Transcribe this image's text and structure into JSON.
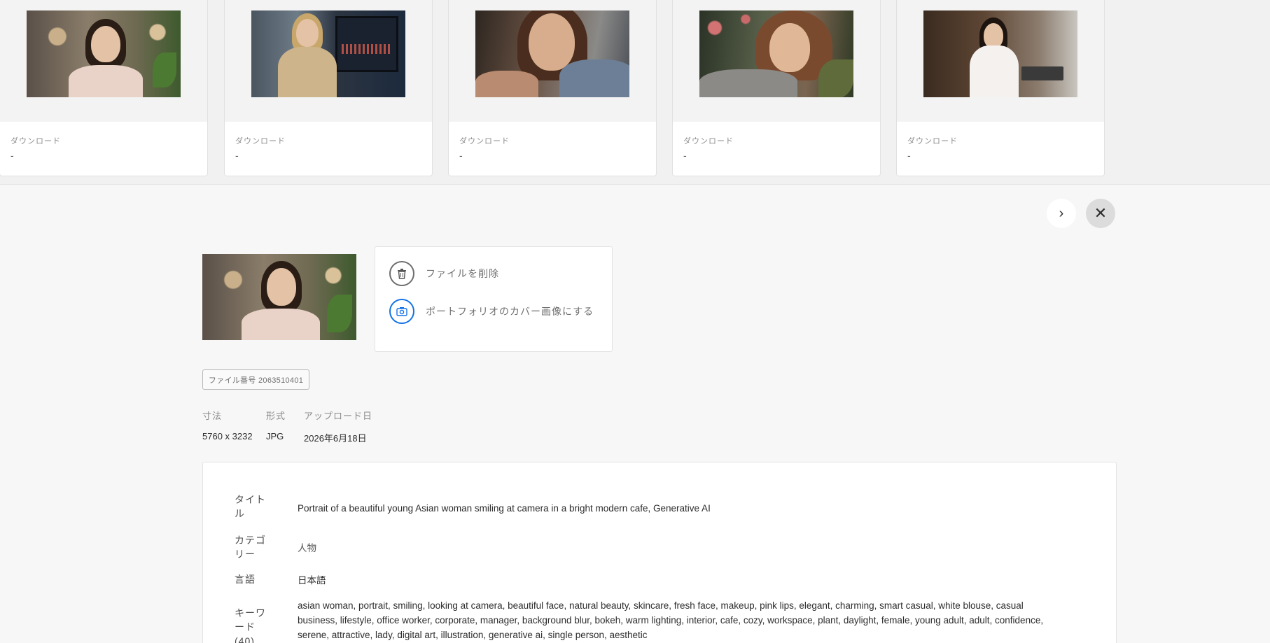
{
  "strip": {
    "cards": [
      {
        "download_label": "ダウンロード",
        "download_value": "-"
      },
      {
        "download_label": "ダウンロード",
        "download_value": "-"
      },
      {
        "download_label": "ダウンロード",
        "download_value": "-"
      },
      {
        "download_label": "ダウンロード",
        "download_value": "-"
      },
      {
        "download_label": "ダウンロード",
        "download_value": "-"
      }
    ]
  },
  "controls": {
    "next_icon": "›",
    "close_icon": "✕"
  },
  "actions": {
    "delete_label": "ファイルを削除",
    "cover_label": "ポートフォリオのカバー画像にする",
    "delete_icon": "trash-icon",
    "cover_icon": "camera-icon"
  },
  "file": {
    "badge": "ファイル番号 2063510401"
  },
  "meta": {
    "dimensions_label": "寸法",
    "format_label": "形式",
    "upload_label": "アップロード日",
    "dimensions_value": "5760 x 3232",
    "format_value": "JPG",
    "upload_value": "2026年6月18日"
  },
  "details": {
    "title_label": "タイトル",
    "title_value": "Portrait of a beautiful young Asian woman smiling at camera in a bright modern cafe, Generative AI",
    "category_label": "カテゴリー",
    "category_value": "人物",
    "language_label": "言語",
    "language_value": "日本語",
    "keywords_label": "キーワード (40)",
    "keywords_value": "asian woman, portrait, smiling, looking at camera, beautiful face, natural beauty, skincare, fresh face, makeup, pink lips, elegant, charming, smart casual, white blouse, casual business, lifestyle, office worker, corporate, manager, background blur, bokeh, warm lighting, interior, cafe, cozy, workspace, plant, daylight, female, young adult, adult, confidence, serene, attractive, lady, digital art, illustration, generative ai, single person, aesthetic"
  }
}
